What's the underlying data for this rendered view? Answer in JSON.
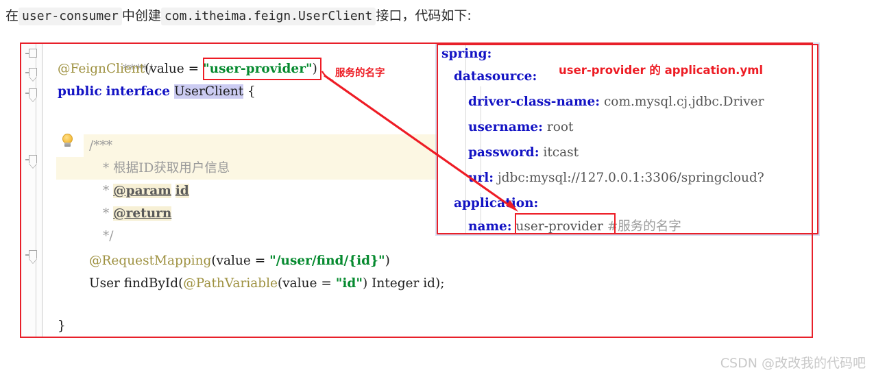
{
  "caption": {
    "prefix_cn": "在",
    "chip1": "user-consumer",
    "middle_cn": "中创建",
    "chip2": "com.itheima.feign.UserClient",
    "suffix_cn": "接口，代码如下:"
  },
  "java_editor": {
    "lines": [
      {
        "id": "l0",
        "text": "****/",
        "kind": "comment-tail"
      },
      {
        "id": "l1",
        "annotation": "@FeignClient",
        "open": "(value = ",
        "quote_open": "\"",
        "value": "user-provider",
        "quote_close": "\"",
        "close": ")"
      },
      {
        "id": "l2",
        "kw1": "public",
        "kw2": "interface",
        "type_name": "UserClient",
        "brace": "{"
      },
      {
        "id": "l3",
        "text": "/***"
      },
      {
        "id": "l4",
        "text": "* 根据ID获取用户信息"
      },
      {
        "id": "l5",
        "star": "*",
        "tag": "@param",
        "arg": "id"
      },
      {
        "id": "l6",
        "star": "*",
        "tag": "@return"
      },
      {
        "id": "l7",
        "text": "*/"
      },
      {
        "id": "l8",
        "annotation": "@RequestMapping",
        "open": "(value = ",
        "quote_open": "\"",
        "value": "/user/find/{id}",
        "quote_close": "\"",
        "close": ")"
      },
      {
        "id": "l9",
        "ret": "User",
        "method": "findById",
        "p1": "(",
        "annotation": "@PathVariable",
        "p2": "(value = ",
        "quote_open": "\"",
        "value": "id",
        "quote_close": "\"",
        "p3": ") ",
        "ptype": "Integer",
        "pname": " id);"
      },
      {
        "id": "l10",
        "text": "}"
      }
    ]
  },
  "yaml_panel": {
    "title_annotation": "user-provider 的  application.yml",
    "lines": [
      {
        "id": "y0",
        "indent": 0,
        "key": "spring:",
        "value": ""
      },
      {
        "id": "y1",
        "indent": 1,
        "key": "datasource:",
        "value": ""
      },
      {
        "id": "y2",
        "indent": 2,
        "key": "driver-class-name:",
        "value": " com.mysql.cj.jdbc.Driver"
      },
      {
        "id": "y3",
        "indent": 2,
        "key": "username:",
        "value": " root"
      },
      {
        "id": "y4",
        "indent": 2,
        "key": "password:",
        "value": " itcast"
      },
      {
        "id": "y5",
        "indent": 2,
        "key": "url:",
        "value": " jdbc:mysql://127.0.0.1:3306/springcloud?"
      },
      {
        "id": "y6",
        "indent": 1,
        "key": "application:",
        "value": ""
      },
      {
        "id": "y7",
        "indent": 2,
        "key": "name:",
        "value": "user-provider",
        "comment": "#服务的名字"
      }
    ]
  },
  "annotations": {
    "service_name_label": "服务的名字",
    "colors": {
      "red": "#ee1c25",
      "frame_red": "#e8202a",
      "string_green": "#068a2f",
      "keyword_blue": "#1313c4",
      "annotation_olive": "#9e9140",
      "comment_gray": "#9b9b9b"
    }
  },
  "watermark": {
    "text": "CSDN @改改我的代码吧"
  }
}
